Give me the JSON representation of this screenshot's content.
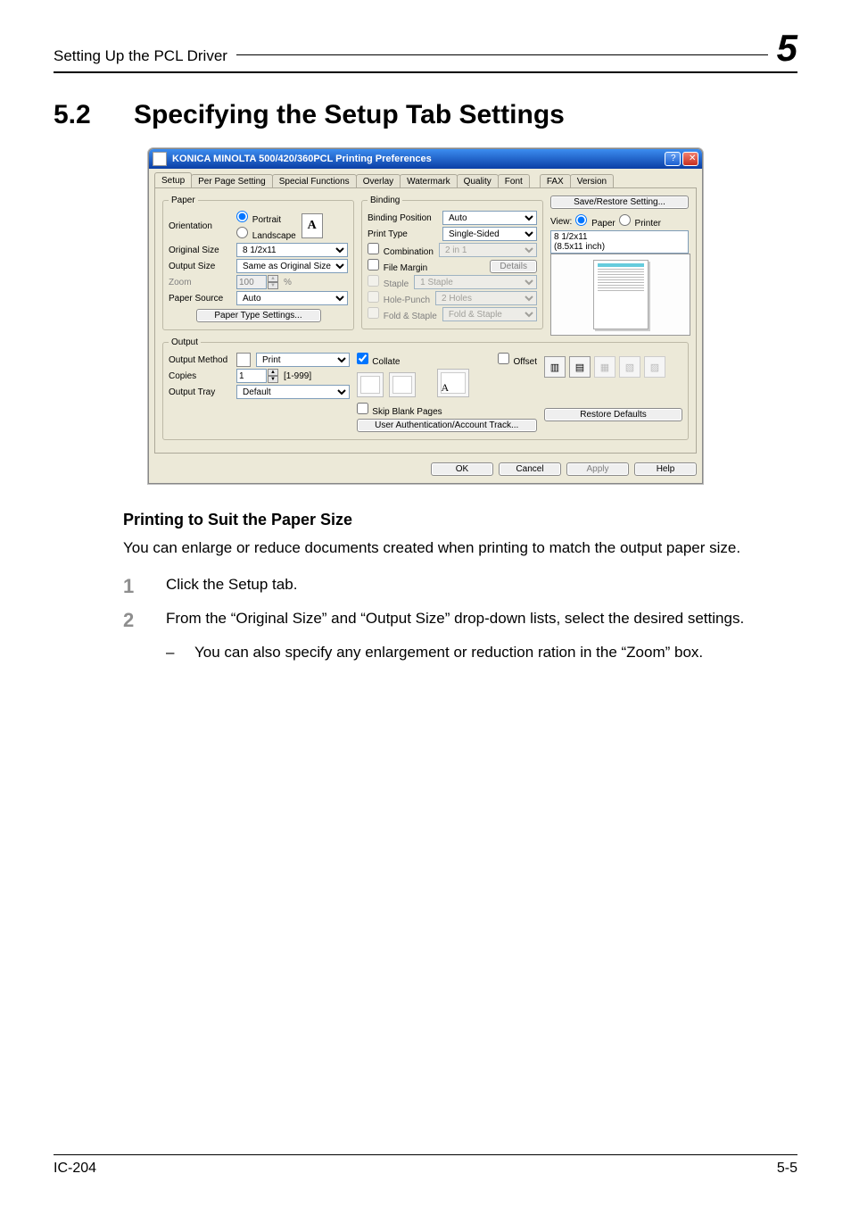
{
  "doc": {
    "running_head": "Setting Up the PCL Driver",
    "chapter_number": "5",
    "section_number": "5.2",
    "section_title": "Specifying the Setup Tab Settings",
    "subheading": "Printing to Suit the Paper Size",
    "intro": "You can enlarge or reduce documents created when printing to match the output paper size.",
    "steps": {
      "s1": "Click the Setup tab.",
      "s2": "From the “Original Size” and “Output Size” drop-down lists, select the desired settings.",
      "s2_sub": "You can also specify any enlargement or reduction ration in the “Zoom” box."
    },
    "footer_left": "IC-204",
    "footer_right": "5-5"
  },
  "dlg": {
    "title": "KONICA MINOLTA 500/420/360PCL Printing Preferences",
    "help_btn": "?",
    "close_btn": "✕",
    "tabs": [
      "Setup",
      "Per Page Setting",
      "Special Functions",
      "Overlay",
      "Watermark",
      "Quality",
      "Font",
      "FAX",
      "Version"
    ],
    "paper": {
      "legend": "Paper",
      "orientation_label": "Orientation",
      "portrait": "Portrait",
      "landscape": "Landscape",
      "orient_icon_letter": "A",
      "original_size_label": "Original Size",
      "original_size_value": "8 1/2x11",
      "output_size_label": "Output Size",
      "output_size_value": "Same as Original Size",
      "zoom_label": "Zoom",
      "zoom_value": "100",
      "zoom_pct": "%",
      "paper_source_label": "Paper Source",
      "paper_source_value": "Auto",
      "paper_type_btn": "Paper Type Settings..."
    },
    "binding": {
      "legend": "Binding",
      "binding_position_label": "Binding Position",
      "binding_position_value": "Auto",
      "print_type_label": "Print Type",
      "print_type_value": "Single-Sided",
      "combination_label": "Combination",
      "combination_value": "2 in 1",
      "file_margin_label": "File Margin",
      "details_btn": "Details",
      "staple_label": "Staple",
      "staple_value": "1 Staple",
      "hole_punch_label": "Hole-Punch",
      "hole_punch_value": "2 Holes",
      "fold_staple_label": "Fold & Staple",
      "fold_staple_value": "Fold & Staple"
    },
    "side": {
      "save_restore_btn": "Save/Restore Setting...",
      "view_label": "View:",
      "view_paper": "Paper",
      "view_printer": "Printer",
      "size_a": "8 1/2x11",
      "size_b": "(8.5x11 inch)"
    },
    "output": {
      "legend": "Output",
      "method_label": "Output Method",
      "method_value": "Print",
      "copies_label": "Copies",
      "copies_value": "1",
      "copies_range": "[1-999]",
      "tray_label": "Output Tray",
      "tray_value": "Default",
      "collate_label": "Collate",
      "offset_label": "Offset",
      "skip_blank_label": "Skip Blank Pages",
      "auth_btn": "User Authentication/Account Track...",
      "restore_btn": "Restore Defaults"
    },
    "buttons": {
      "ok": "OK",
      "cancel": "Cancel",
      "apply": "Apply",
      "help": "Help"
    }
  }
}
